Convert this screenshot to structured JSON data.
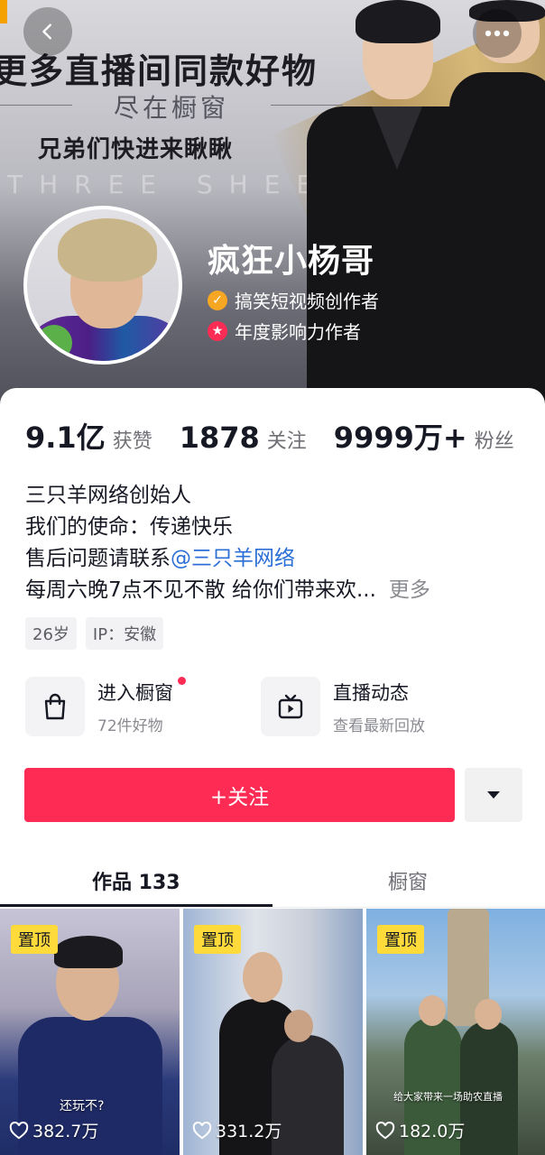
{
  "banner": {
    "headline": "更多直播间同款好物",
    "subline": "尽在橱窗",
    "line3": "兄弟们快进来瞅瞅",
    "watermark": "THREE SHEEP"
  },
  "nav": {
    "back_icon": "chevron-left-icon",
    "more_icon": "more-dots-icon"
  },
  "profile": {
    "name": "疯狂小杨哥",
    "badges": [
      {
        "icon": "verified-check-icon",
        "text": "搞笑短视频创作者",
        "color": "#f5a623"
      },
      {
        "icon": "star-badge-icon",
        "text": "年度影响力作者",
        "color": "#fe2c55"
      }
    ]
  },
  "stats": [
    {
      "value": "9.1亿",
      "label": "获赞"
    },
    {
      "value": "1878",
      "label": "关注"
    },
    {
      "value": "9999万+",
      "label": "粉丝"
    }
  ],
  "bio": {
    "line1": "三只羊网络创始人",
    "line2": "我们的使命：传递快乐",
    "line3_prefix": "售后问题请联系",
    "line3_mention": "@三只羊网络",
    "line4": "每周六晚7点不见不散  给你们带来欢...",
    "more": "更多"
  },
  "tags": [
    "26岁",
    "IP：安徽"
  ],
  "entries": [
    {
      "icon": "shopping-bag-icon",
      "title": "进入橱窗",
      "subtitle": "72件好物"
    },
    {
      "icon": "live-tv-icon",
      "title": "直播动态",
      "subtitle": "查看最新回放"
    }
  ],
  "follow_button": "+关注",
  "dropdown_icon": "caret-down-icon",
  "tabs": [
    {
      "label": "作品 133",
      "active": true
    },
    {
      "label": "橱窗",
      "active": false
    }
  ],
  "videos": [
    {
      "pinned": "置顶",
      "likes": "382.7万",
      "caption": "还玩不?"
    },
    {
      "pinned": "置顶",
      "likes": "331.2万",
      "caption": ""
    },
    {
      "pinned": "置顶",
      "likes": "182.0万",
      "caption": "给大家带来一场助农直播"
    }
  ],
  "colors": {
    "accent": "#fe2c55",
    "link": "#2b6fd6",
    "pin": "#fedb3b"
  }
}
